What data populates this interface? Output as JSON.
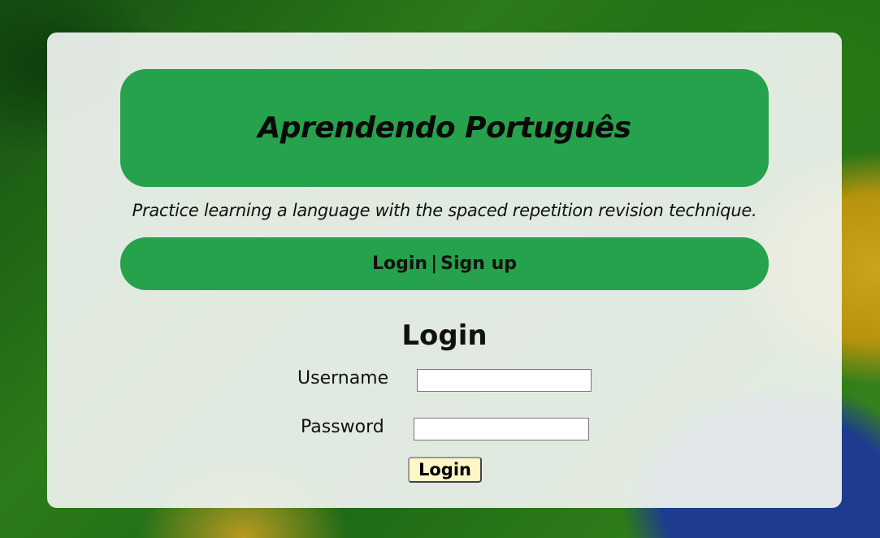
{
  "header": {
    "title": "Aprendendo Português",
    "tagline": "Practice learning a language with the spaced repetition revision technique."
  },
  "nav": {
    "login_link": "Login",
    "separator": "|",
    "signup_link": "Sign up"
  },
  "login_form": {
    "heading": "Login",
    "username_label": "Username",
    "username_value": "",
    "password_label": "Password",
    "password_value": "",
    "submit_label": "Login"
  },
  "colors": {
    "accent_green": "#26a14c",
    "card_background": "#f0f3f0",
    "button_background": "#fdf6c7"
  }
}
